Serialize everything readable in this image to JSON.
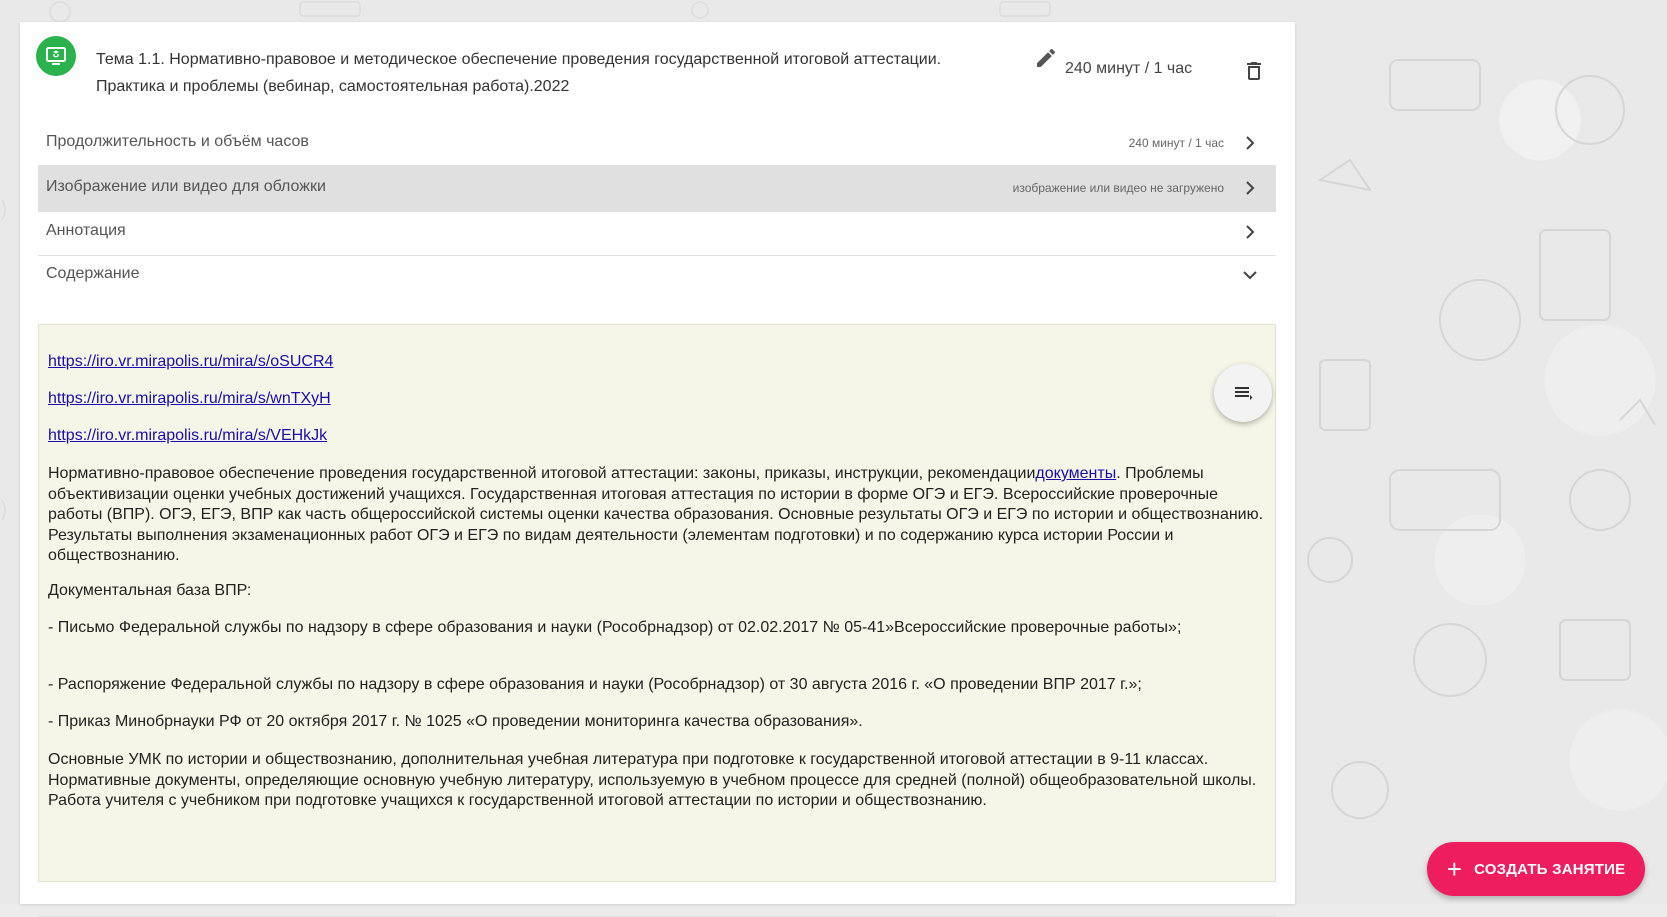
{
  "topic": {
    "title": "Тема 1.1. Нормативно-правовое и методическое обеспечение проведения государственной итоговой аттестации. Практика и проблемы (вебинар, самостоятельная работа).2022",
    "duration": "240 минут / 1 час",
    "icon": "topic-icon"
  },
  "rows": [
    {
      "label": "Продолжительность и объём часов",
      "value": "240 минут / 1 час",
      "arrow": "chevron-right-icon"
    },
    {
      "label": "Изображение или видео для обложки",
      "value": "изображение или видео не загружено",
      "arrow": "chevron-right-icon"
    },
    {
      "label": "Аннотация",
      "value": "",
      "arrow": "chevron-right-icon"
    },
    {
      "label": "Содержание",
      "value": "",
      "arrow": "chevron-down-icon"
    }
  ],
  "content": {
    "links": [
      "https://iro.vr.mirapolis.ru/mira/s/oSUCR4",
      "https://iro.vr.mirapolis.ru/mira/s/wnTXyH",
      "https://iro.vr.mirapolis.ru/mira/s/VEHkJk"
    ],
    "para1_text": "Нормативно-правовое обеспечение проведения государственной итоговой аттестации: законы, приказы, инструкции, рекомендации",
    "para1_link": "документы",
    "para1_rest": ". Проблемы объективизации оценки учебных достижений учащихся. Государственная итоговая аттестация по истории в форме ОГЭ и ЕГЭ. Всероссийские проверочные работы (ВПР). ОГЭ, ЕГЭ, ВПР как часть общероссийской системы оценки качества образования. Основные результаты ОГЭ и ЕГЭ по истории и обществознанию. Результаты выполнения экзаменационных работ ОГЭ и ЕГЭ по видам деятельности (элементам подготовки) и по содержанию курса истории России и обществознанию.",
    "para2": "Документальная база ВПР:",
    "para3": "- Письмо Федеральной службы по надзору в сфере образования и науки (Рособрнадзор) от 02.02.2017 № 05-41»Всероссийские проверочные работы»;",
    "para4": "- Распоряжение Федеральной службы по надзору в сфере образования и науки (Рособрнадзор) от 30 августа 2016 г. «О проведении ВПР 2017 г.»;",
    "para5": "- Приказ Минобрнауки РФ от 20 октября 2017 г. № 1025 «О проведении мониторинга качества образования».",
    "para6": "Основные УМК по истории и обществознанию, дополнительная учебная литература при подготовке к государственной итоговой аттестации в 9-11 классах. Нормативные документы, определяющие основную учебную литературу, используемую в учебном процессе для средней (полной) общеобразовательной школы. Работа учителя с учебником при подготовке учащихся к государственной итоговой аттестации по истории и обществознанию."
  },
  "create_button": {
    "label": "СОЗДАТЬ ЗАНЯТИЕ",
    "plus": "+"
  },
  "colors": {
    "accent": "#ed1d5e",
    "topic_icon": "#2bb24c",
    "link": "#1a0dab",
    "content_bg": "#f6f6e8"
  }
}
